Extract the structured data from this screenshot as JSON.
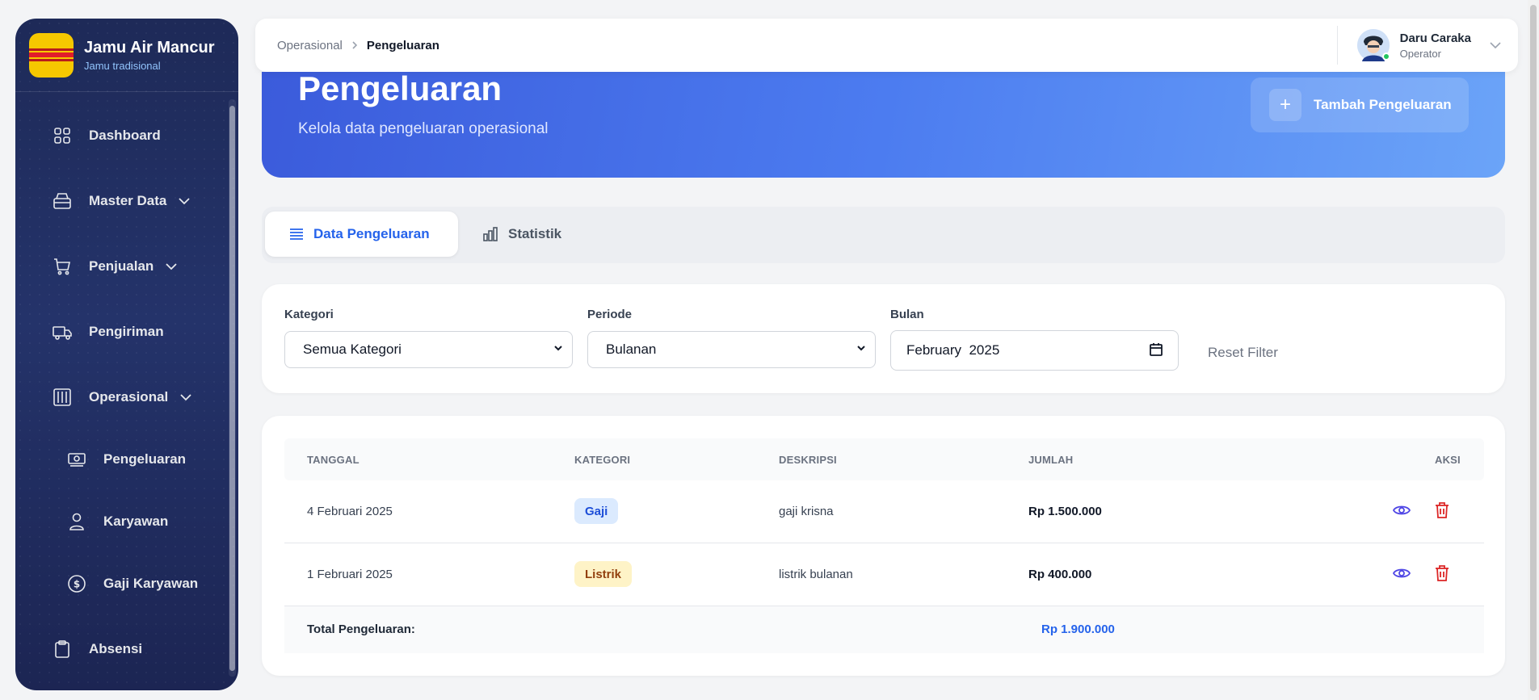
{
  "sidebar": {
    "brand_name": "Jamu Air Mancur",
    "brand_sub": "Jamu tradisional",
    "items": [
      {
        "label": "Dashboard",
        "icon": "grid-icon"
      },
      {
        "label": "Master Data",
        "icon": "box-icon",
        "expandable": true
      },
      {
        "label": "Penjualan",
        "icon": "cart-icon",
        "expandable": true
      },
      {
        "label": "Pengiriman",
        "icon": "truck-icon"
      },
      {
        "label": "Operasional",
        "icon": "columns-icon",
        "expandable": true
      },
      {
        "label": "Pengeluaran",
        "icon": "cash-icon"
      },
      {
        "label": "Karyawan",
        "icon": "user-icon"
      },
      {
        "label": "Gaji Karyawan",
        "icon": "dollar-icon"
      },
      {
        "label": "Absensi",
        "icon": "clipboard-icon"
      }
    ]
  },
  "topbar": {
    "breadcrumb": [
      "Operasional",
      "Pengeluaran"
    ],
    "user_name": "Daru Caraka",
    "user_role": "Operator"
  },
  "hero": {
    "title": "Pengeluaran",
    "subtitle": "Kelola data pengeluaran operasional",
    "add_button": "Tambah Pengeluaran"
  },
  "tabs": [
    "Data Pengeluaran",
    "Statistik"
  ],
  "filters": {
    "kategori_label": "Kategori",
    "kategori_value": "Semua Kategori",
    "periode_label": "Periode",
    "periode_value": "Bulanan",
    "bulan_label": "Bulan",
    "bulan_value": "February  2025",
    "reset": "Reset Filter"
  },
  "table": {
    "headers": [
      "TANGGAL",
      "KATEGORI",
      "DESKRIPSI",
      "JUMLAH",
      "AKSI"
    ],
    "rows": [
      {
        "tanggal": "4 Februari 2025",
        "kategori": "Gaji",
        "deskripsi": "gaji krisna",
        "jumlah": "Rp 1.500.000"
      },
      {
        "tanggal": "1 Februari 2025",
        "kategori": "Listrik",
        "deskripsi": "listrik bulanan",
        "jumlah": "Rp 400.000"
      }
    ],
    "total_label": "Total Pengeluaran:",
    "total_value": "Rp 1.900.000"
  },
  "colors": {
    "sidebar": "#1e2a58",
    "accent": "#2563eb",
    "hero_start": "#3b5bdb",
    "hero_end": "#6ba4f8",
    "delete": "#dc2626",
    "view": "#4f46e5"
  }
}
